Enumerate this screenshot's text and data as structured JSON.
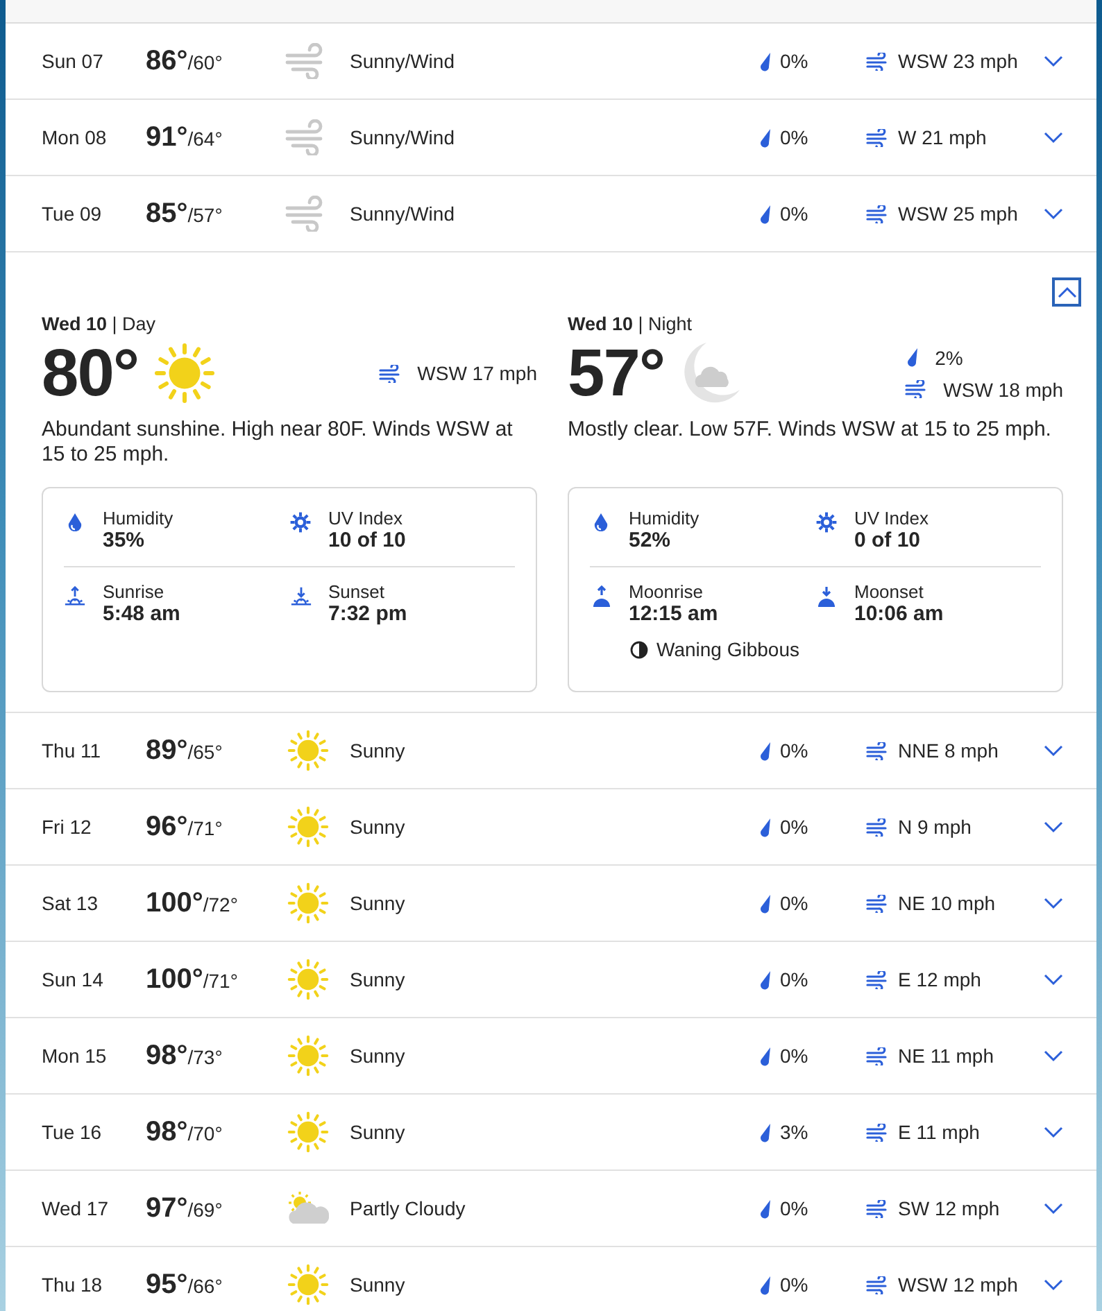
{
  "days": [
    {
      "date": "Sun 07",
      "high": "86°",
      "low": "/60°",
      "kind": "wind",
      "condition": "Sunny/Wind",
      "precip": "0%",
      "wind": "WSW 23 mph",
      "expanded": false
    },
    {
      "date": "Mon 08",
      "high": "91°",
      "low": "/64°",
      "kind": "wind",
      "condition": "Sunny/Wind",
      "precip": "0%",
      "wind": "W 21 mph",
      "expanded": false
    },
    {
      "date": "Tue 09",
      "high": "85°",
      "low": "/57°",
      "kind": "wind",
      "condition": "Sunny/Wind",
      "precip": "0%",
      "wind": "WSW 25 mph",
      "expanded": false
    },
    {
      "expanded": true,
      "day": {
        "heading": "**Wed 10** | Day",
        "temp": "80°",
        "wind": "WSW 17 mph",
        "description": "Abundant sunshine. High near 80F. Winds WSW at 15 to 25 mph.",
        "stats": [
          {
            "kind": "humidity",
            "label": "Humidity",
            "value": "35%"
          },
          {
            "kind": "uv",
            "label": "UV Index",
            "value": "10 of 10"
          },
          {
            "kind": "sunrise",
            "label": "Sunrise",
            "value": "5:48 am"
          },
          {
            "kind": "sunset",
            "label": "Sunset",
            "value": "7:32 pm"
          }
        ]
      },
      "night": {
        "heading": "**Wed 10** | Night",
        "temp": "57°",
        "precip": "2%",
        "wind": "WSW 18 mph",
        "description": "Mostly clear. Low 57F. Winds WSW at 15 to 25 mph.",
        "stats": [
          {
            "kind": "humidity",
            "label": "Humidity",
            "value": "52%"
          },
          {
            "kind": "uv",
            "label": "UV Index",
            "value": "0 of 10"
          },
          {
            "kind": "moonrise",
            "label": "Moonrise",
            "value": "12:15 am"
          },
          {
            "kind": "moonset",
            "label": "Moonset",
            "value": "10:06 am"
          }
        ],
        "moon_phase": "Waning Gibbous"
      }
    },
    {
      "date": "Thu 11",
      "high": "89°",
      "low": "/65°",
      "kind": "sunny",
      "condition": "Sunny",
      "precip": "0%",
      "wind": "NNE 8 mph",
      "expanded": false
    },
    {
      "date": "Fri 12",
      "high": "96°",
      "low": "/71°",
      "kind": "sunny",
      "condition": "Sunny",
      "precip": "0%",
      "wind": "N 9 mph",
      "expanded": false
    },
    {
      "date": "Sat 13",
      "high": "100°",
      "low": "/72°",
      "kind": "sunny",
      "condition": "Sunny",
      "precip": "0%",
      "wind": "NE 10 mph",
      "expanded": false
    },
    {
      "date": "Sun 14",
      "high": "100°",
      "low": "/71°",
      "kind": "sunny",
      "condition": "Sunny",
      "precip": "0%",
      "wind": "E 12 mph",
      "expanded": false
    },
    {
      "date": "Mon 15",
      "high": "98°",
      "low": "/73°",
      "kind": "sunny",
      "condition": "Sunny",
      "precip": "0%",
      "wind": "NE 11 mph",
      "expanded": false
    },
    {
      "date": "Tue 16",
      "high": "98°",
      "low": "/70°",
      "kind": "sunny",
      "condition": "Sunny",
      "precip": "3%",
      "wind": "E 11 mph",
      "expanded": false
    },
    {
      "date": "Wed 17",
      "high": "97°",
      "low": "/69°",
      "kind": "partly_cloudy",
      "condition": "Partly Cloudy",
      "precip": "0%",
      "wind": "SW 12 mph",
      "expanded": false
    },
    {
      "date": "Thu 18",
      "high": "95°",
      "low": "/66°",
      "kind": "sunny",
      "condition": "Sunny",
      "precip": "0%",
      "wind": "WSW 12 mph",
      "expanded": false
    }
  ]
}
